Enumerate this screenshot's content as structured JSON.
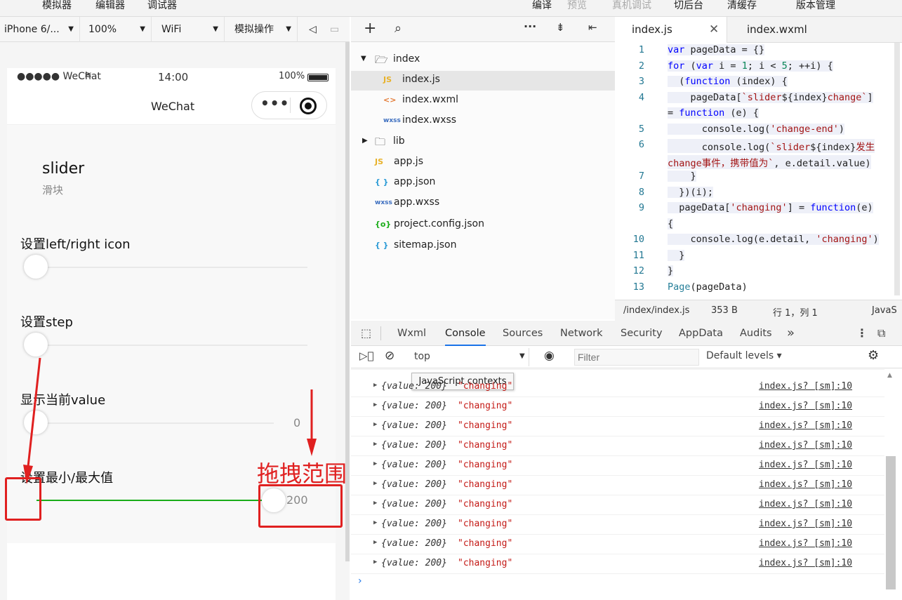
{
  "menu": {
    "items": [
      "模拟器",
      "编辑器",
      "调试器",
      "编译",
      "预览",
      "真机调试",
      "切后台",
      "清缓存",
      "版本管理"
    ]
  },
  "device_toolbar": {
    "device": "iPhone 6/...",
    "zoom": "100%",
    "network": "WiFi",
    "ops": "模拟操作"
  },
  "phone": {
    "status": {
      "carrier": "●●●●● WeChat",
      "time": "14:00",
      "battery": "100%"
    },
    "nav_title": "WeChat",
    "page_title": "slider",
    "page_subtitle": "滑块",
    "sections": [
      {
        "label": "设置left/right icon"
      },
      {
        "label": "设置step"
      },
      {
        "label": "显示当前value",
        "value": "0"
      },
      {
        "label": "设置最小/最大值",
        "value": "200"
      }
    ]
  },
  "annotation": {
    "text": "拖拽范围",
    "color": "#e02020"
  },
  "explorer": {
    "items": [
      {
        "name": "index",
        "icon": "folder-open-icon",
        "indent": 0
      },
      {
        "name": "index.js",
        "icon": "js-file-icon",
        "badge": "JS",
        "indent": 1,
        "selected": true
      },
      {
        "name": "index.wxml",
        "icon": "wxml-file-icon",
        "badge": "<>",
        "indent": 1
      },
      {
        "name": "index.wxss",
        "icon": "wxss-file-icon",
        "badge": "wxss",
        "indent": 1
      },
      {
        "name": "lib",
        "icon": "folder-closed-icon",
        "indent": 0
      },
      {
        "name": "app.js",
        "icon": "js-file-icon",
        "badge": "JS",
        "indent": 0
      },
      {
        "name": "app.json",
        "icon": "json-file-icon",
        "badge": "{ }",
        "indent": 0
      },
      {
        "name": "app.wxss",
        "icon": "wxss-file-icon",
        "badge": "wxss",
        "indent": 0
      },
      {
        "name": "project.config.json",
        "icon": "config-file-icon",
        "badge": "{o}",
        "indent": 0
      },
      {
        "name": "sitemap.json",
        "icon": "json-file-icon",
        "badge": "{ }",
        "indent": 0
      }
    ]
  },
  "editor": {
    "tabs": [
      "index.js",
      "index.wxml"
    ],
    "status": {
      "path": "/index/index.js",
      "size": "353 B",
      "pos": "行 1，列 1",
      "lang": "JavaS"
    }
  },
  "devtools": {
    "tabs": [
      "Wxml",
      "Console",
      "Sources",
      "Network",
      "Security",
      "AppData",
      "Audits"
    ],
    "context": "top",
    "filter_placeholder": "Filter",
    "levels": "Default levels",
    "tooltip": "JavaScript contexts",
    "rows": [
      {
        "obj": "{value: 200}",
        "str": "\"changing\"",
        "src": "index.js? [sm]:10"
      },
      {
        "obj": "{value: 200}",
        "str": "\"changing\"",
        "src": "index.js? [sm]:10"
      },
      {
        "obj": "{value: 200}",
        "str": "\"changing\"",
        "src": "index.js? [sm]:10"
      },
      {
        "obj": "{value: 200}",
        "str": "\"changing\"",
        "src": "index.js? [sm]:10"
      },
      {
        "obj": "{value: 200}",
        "str": "\"changing\"",
        "src": "index.js? [sm]:10"
      },
      {
        "obj": "{value: 200}",
        "str": "\"changing\"",
        "src": "index.js? [sm]:10"
      },
      {
        "obj": "{value: 200}",
        "str": "\"changing\"",
        "src": "index.js? [sm]:10"
      },
      {
        "obj": "{value: 200}",
        "str": "\"changing\"",
        "src": "index.js? [sm]:10"
      },
      {
        "obj": "{value: 200}",
        "str": "\"changing\"",
        "src": "index.js? [sm]:10"
      },
      {
        "obj": "{value: 200}",
        "str": "\"changing\"",
        "src": "index.js? [sm]:10"
      }
    ]
  }
}
